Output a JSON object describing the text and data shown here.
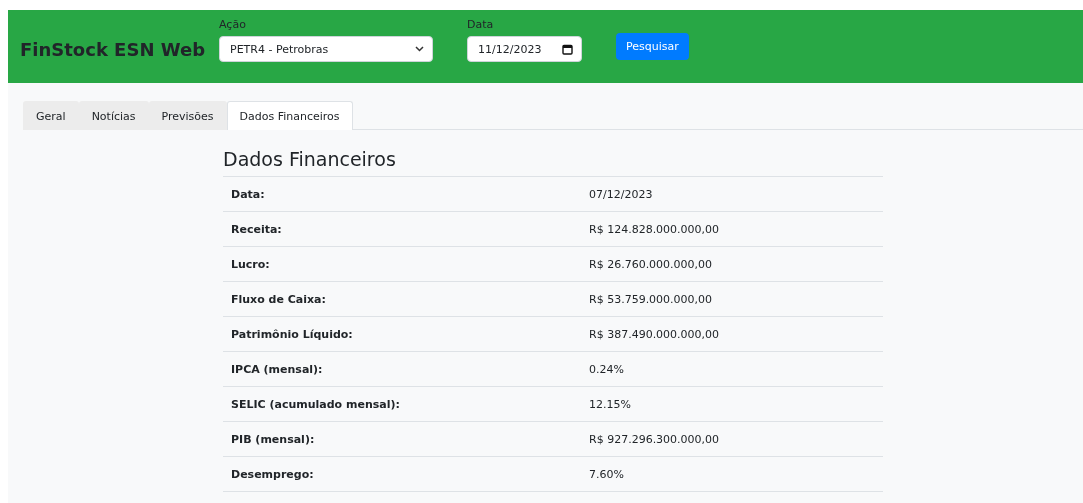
{
  "brand": "FinStock ESN Web",
  "filters": [
    {
      "kind": "select",
      "label": "Ação",
      "value": "PETR4 - Petrobras"
    },
    {
      "kind": "date",
      "label": "Data",
      "value": "11/12/2023"
    }
  ],
  "search_button": "Pesquisar",
  "tabs": [
    {
      "label": "Geral",
      "selected": false
    },
    {
      "label": "Notícias",
      "selected": false
    },
    {
      "label": "Previsões",
      "selected": false
    },
    {
      "label": "Dados Financeiros",
      "selected": true
    }
  ],
  "section_title": "Dados Financeiros",
  "rows": [
    {
      "label": "Data:",
      "value": "07/12/2023"
    },
    {
      "label": "Receita:",
      "value": "R$ 124.828.000.000,00"
    },
    {
      "label": "Lucro:",
      "value": "R$ 26.760.000.000,00"
    },
    {
      "label": "Fluxo de Caixa:",
      "value": "R$ 53.759.000.000,00"
    },
    {
      "label": "Patrimônio Líquido:",
      "value": "R$ 387.490.000.000,00"
    },
    {
      "label": "IPCA (mensal):",
      "value": "0.24%"
    },
    {
      "label": "SELIC (acumulado mensal):",
      "value": "12.15%"
    },
    {
      "label": "PIB (mensal):",
      "value": "R$ 927.296.300.000,00"
    },
    {
      "label": "Desemprego:",
      "value": "7.60%"
    }
  ]
}
